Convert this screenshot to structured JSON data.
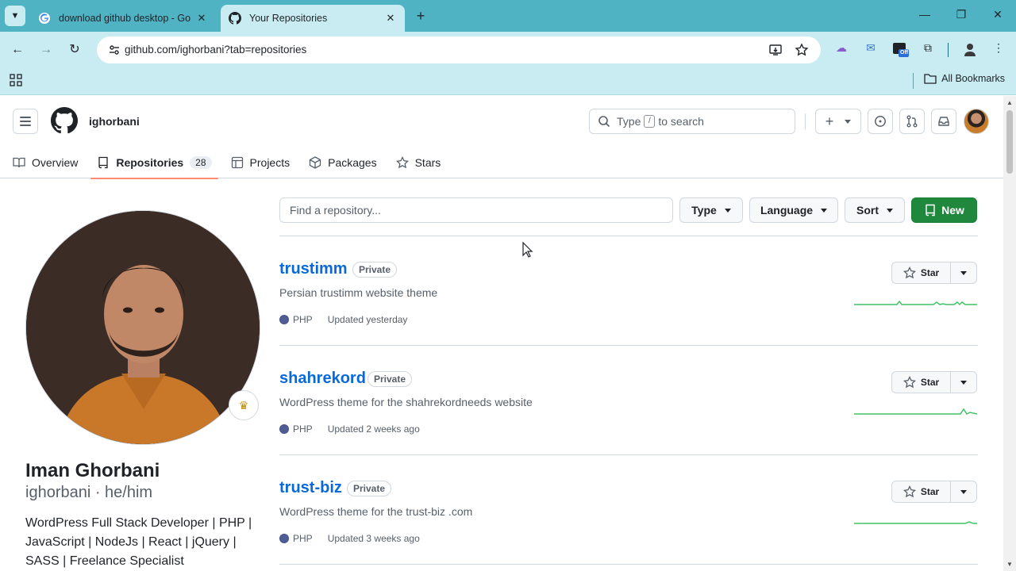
{
  "browser": {
    "tabs": [
      {
        "title": "download github desktop - Go",
        "active": false
      },
      {
        "title": "Your Repositories",
        "active": true
      }
    ],
    "url": "github.com/ighorbani?tab=repositories",
    "bookmarks_label": "All Bookmarks",
    "extension_badge": "Off"
  },
  "header": {
    "username": "ighorbani",
    "search_pre": "Type",
    "search_key": "/",
    "search_post": "to search"
  },
  "profile_tabs": [
    {
      "label": "Overview"
    },
    {
      "label": "Repositories",
      "count": "28"
    },
    {
      "label": "Projects"
    },
    {
      "label": "Packages"
    },
    {
      "label": "Stars"
    }
  ],
  "profile": {
    "full_name": "Iman Ghorbani",
    "login_line": "ighorbani · he/him",
    "bio": "WordPress Full Stack Developer | PHP | JavaScript | NodeJs | React | jQuery | SASS | Freelance Specialist"
  },
  "repo_toolbar": {
    "filter_placeholder": "Find a repository...",
    "type_label": "Type",
    "language_label": "Language",
    "sort_label": "Sort",
    "new_label": "New"
  },
  "repos": [
    {
      "name": "trustimm",
      "visibility": "Private",
      "description": "Persian trustimm website theme",
      "language": "PHP",
      "updated": "Updated yesterday",
      "star_label": "Star"
    },
    {
      "name": "shahrekord",
      "visibility": "Private",
      "description": "WordPress theme for the shahrekordneeds website",
      "language": "PHP",
      "updated": "Updated 2 weeks ago",
      "star_label": "Star"
    },
    {
      "name": "trust-biz",
      "visibility": "Private",
      "description": "WordPress theme for the trust-biz .com",
      "language": "PHP",
      "updated": "Updated 3 weeks ago",
      "star_label": "Star"
    }
  ],
  "colors": {
    "accent_green": "#1f883d",
    "link_blue": "#0969da",
    "php_color": "#4F5D95",
    "tab_underline": "#fd8c73",
    "chrome_teal": "#4fb3c4"
  }
}
